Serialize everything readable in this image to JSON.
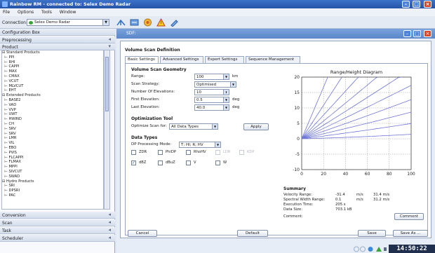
{
  "app": {
    "title": "Rainbow RM - connected to: Selex Demo Radar"
  },
  "menu": [
    "File",
    "Options",
    "Tools",
    "Window"
  ],
  "toolbar": {
    "connection_label": "Connection:",
    "connection_value": "Selex Demo Radar"
  },
  "left_panel": {
    "config_box": "Configuration Box",
    "preprocessing": "Preprocessing",
    "product": "Product",
    "conversion": "Conversion",
    "scan": "Scan",
    "task": "Task",
    "scheduler": "Scheduler",
    "tree": [
      "⊟ Standard Products",
      "  ⊢ PPI",
      "  ⊢ RHI",
      "  ⊢ CAPPI",
      "  ⊢ MAX",
      "  ⊢ CMAX",
      "  ⊢ VCUT",
      "  ⊢ MLVCUT",
      "  ⊢ EHT",
      "⊟ Extended Products",
      "  ⊢ BASE2",
      "  ⊢ VAD",
      "  ⊢ VVP",
      "  ⊢ UWT",
      "  ⊢ HWIND",
      "  ⊢ CH",
      "  ⊢ SRV",
      "  ⊢ SRV",
      "  ⊢ LMR",
      "  ⊢ VIL",
      "  ⊢ EBO",
      "  ⊢ PVIS",
      "  ⊢ FLCAPPI",
      "  ⊢ FLMAX",
      "  ⊢ MPPI",
      "  ⊢ SIVCUT",
      "  ⊢ SWAD",
      "⊟ Hydro Products",
      "  ⊢ SRI",
      "  ⊢ DPSRI",
      "  ⊢ PAC"
    ]
  },
  "sdf": {
    "window_title": "SDF:",
    "heading": "Volume Scan Definition",
    "tabs": [
      "Basic Settings",
      "Advanced Settings",
      "Expert Settings",
      "Sequence Management"
    ],
    "geometry": {
      "title": "Volume Scan Geometry",
      "range_label": "Range:",
      "range_value": "100",
      "range_unit": "km",
      "strategy_label": "Scan Strategy:",
      "strategy_value": "Optimised",
      "nelev_label": "Number Of Elevations:",
      "nelev_value": "10",
      "first_label": "First Elevation:",
      "first_value": "0.5",
      "first_unit": "deg",
      "last_label": "Last Elevation:",
      "last_value": "40.0",
      "last_unit": "deg"
    },
    "optimization": {
      "title": "Optimization Tool",
      "label": "Optimize Scan for:",
      "value": "All Data Types",
      "apply": "Apply"
    },
    "data_types": {
      "title": "Data Types",
      "mode_label": "DP Processing Mode:",
      "mode_value": "T; HI; R; HV",
      "row1": [
        {
          "label": "ZDR",
          "checked": false,
          "enabled": true
        },
        {
          "label": "PhiDP",
          "checked": false,
          "enabled": true
        },
        {
          "label": "RhoHV",
          "checked": false,
          "enabled": true
        },
        {
          "label": "LDR",
          "checked": false,
          "enabled": false
        },
        {
          "label": "KDP",
          "checked": false,
          "enabled": false
        }
      ],
      "row2": [
        {
          "label": "dBZ",
          "checked": true,
          "enabled": true
        },
        {
          "label": "dBuZ",
          "checked": false,
          "enabled": true
        },
        {
          "label": "V",
          "checked": false,
          "enabled": true
        },
        {
          "label": "W",
          "checked": false,
          "enabled": true
        }
      ]
    },
    "summary": {
      "title": "Summary",
      "velocity_label": "Velocity Range:",
      "velocity_min": "-31.4",
      "velocity_unit1": "m/s",
      "velocity_max": "31.4 m/s",
      "spectral_label": "Spectral Width Range:",
      "spectral_min": "0.1",
      "spectral_unit1": "m/s",
      "spectral_max": "31.2 m/s",
      "exec_label": "Execution Time:",
      "exec_value": "205 s",
      "size_label": "Data Size:",
      "size_value": "703.1 kB",
      "comment_label": "Comment:",
      "comment_button": "Comment"
    },
    "buttons": {
      "cancel": "Cancel",
      "default": "Default",
      "save": "Save",
      "save_as": "Save As ..."
    }
  },
  "chart_data": {
    "type": "line",
    "title": "Range/Height Diagram",
    "xlabel": "",
    "ylabel": "",
    "xlim": [
      0,
      100
    ],
    "ylim": [
      -10,
      20
    ],
    "x_ticks": [
      0,
      20,
      40,
      60,
      80,
      100
    ],
    "y_ticks": [
      -10,
      -5,
      0,
      5,
      10,
      15,
      20
    ],
    "grid": true,
    "elevations_deg": [
      0.5,
      2.5,
      4.6,
      6.9,
      9.5,
      12.4,
      16.0,
      21.0,
      28.5,
      40.0
    ]
  },
  "clock": "14:50:22",
  "colors": {
    "titlebar": "#2553a8",
    "rays": "#6f76d6",
    "grid": "#9a9a9a"
  }
}
